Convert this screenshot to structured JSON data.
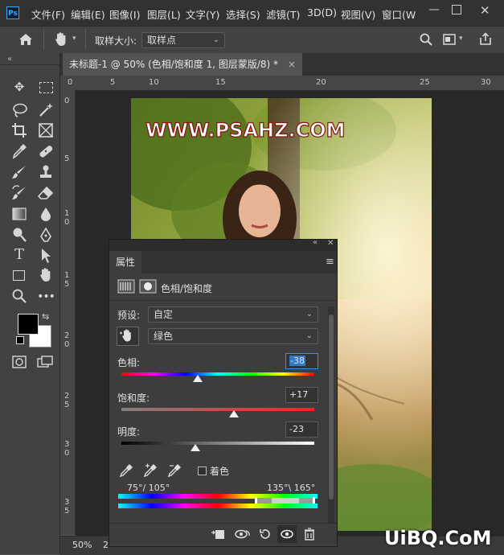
{
  "app": {
    "logo": "Ps"
  },
  "menu": [
    {
      "id": "file",
      "label": "文件(F)"
    },
    {
      "id": "edit",
      "label": "编辑(E)"
    },
    {
      "id": "image",
      "label": "图像(I)"
    },
    {
      "id": "layer",
      "label": "图层(L)"
    },
    {
      "id": "type",
      "label": "文字(Y)"
    },
    {
      "id": "select",
      "label": "选择(S)"
    },
    {
      "id": "filter",
      "label": "滤镜(T)"
    },
    {
      "id": "3d",
      "label": "3D(D)"
    },
    {
      "id": "view",
      "label": "视图(V)"
    },
    {
      "id": "window",
      "label": "窗口(W"
    }
  ],
  "options_bar": {
    "sample_size_label": "取样大小:",
    "sample_size_value": "取样点"
  },
  "document": {
    "tab_title": "未标题-1 @ 50% (色相/饱和度 1, 图层蒙版/8) *",
    "zoom": "50%",
    "status_extra": "2"
  },
  "ruler_top": [
    "0",
    "5",
    "10",
    "15",
    "20",
    "25",
    "30"
  ],
  "ruler_left": [
    "0",
    "5",
    "1\n0",
    "1\n5",
    "2\n0",
    "2\n5",
    "3\n0",
    "3\n5"
  ],
  "watermark": "WWW.PSAHZ.COM",
  "corner_logo": "UiBQ.CoM",
  "properties_panel": {
    "tab": "属性",
    "title": "色相/饱和度",
    "preset_label": "预设:",
    "preset_value": "自定",
    "channel_value": "绿色",
    "hue": {
      "label": "色相:",
      "value": "-38",
      "level": -38
    },
    "saturation": {
      "label": "饱和度:",
      "value": "+17",
      "level": 17
    },
    "lightness": {
      "label": "明度:",
      "value": "-23",
      "level": -23
    },
    "colorize_label": "着色",
    "range_left": "75°/ 105°",
    "range_right": "135°\\ 165°"
  },
  "colors": {
    "accent": "#31a8ff",
    "menubar": "#323232",
    "panel": "#3d3d3d"
  }
}
